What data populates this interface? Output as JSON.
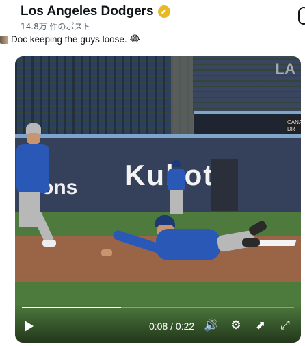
{
  "account": {
    "name": "Los Angeles Dodgers",
    "verified_mark": "✔",
    "post_count": "14.8万 件のポスト"
  },
  "tweet": {
    "text": "Doc keeping the guys loose.",
    "emoji": "😂"
  },
  "video": {
    "sign_main": "Kubota",
    "sign_left": "ons",
    "sign_right": "CANA DR",
    "time_display": "0:08 / 0:22",
    "progress_fraction": 0.364,
    "watermark": "LA",
    "controls": {
      "play": "play-icon",
      "volume": "🔊",
      "settings": "⚙",
      "popout": "⬈",
      "fullscreen": "⤢"
    }
  },
  "colors": {
    "verified": "#e8b923",
    "dodger_blue": "#2a58b6"
  }
}
